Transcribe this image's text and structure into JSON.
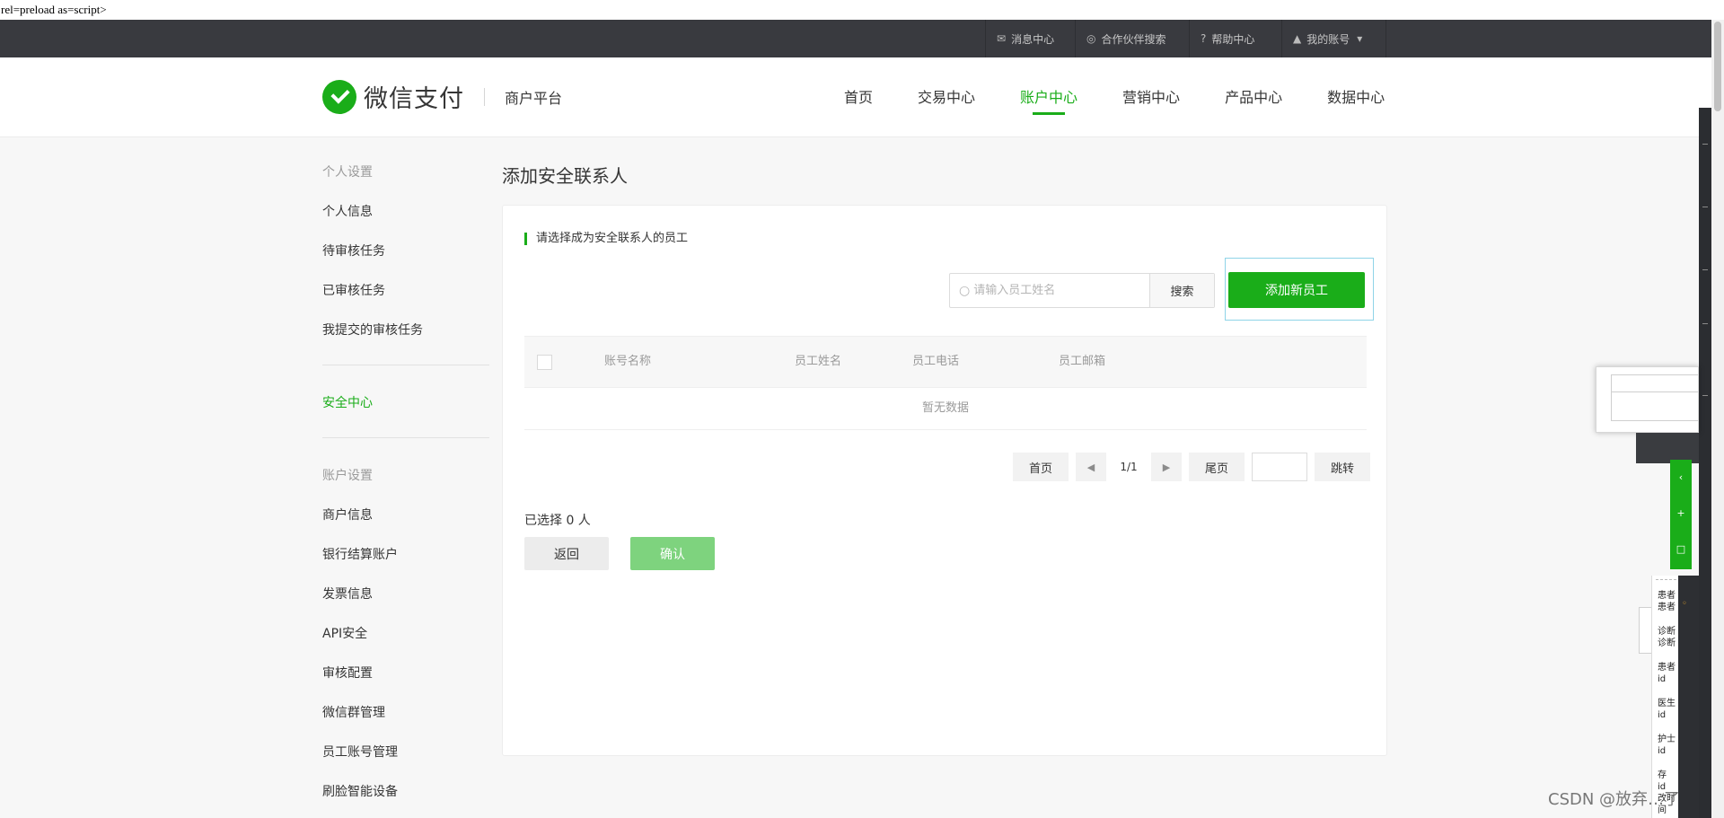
{
  "raw_text": "rel=preload as=script>",
  "topbar": {
    "items": [
      {
        "label": "消息中心",
        "icon": "mail-icon"
      },
      {
        "label": "合作伙伴搜索",
        "icon": "partner-search-icon"
      },
      {
        "label": "帮助中心",
        "icon": "help-icon"
      },
      {
        "label": "我的账号",
        "icon": "user-icon"
      }
    ]
  },
  "header": {
    "brand": "微信支付",
    "platform": "商户平台"
  },
  "nav": {
    "items": [
      "首页",
      "交易中心",
      "账户中心",
      "营销中心",
      "产品中心",
      "数据中心"
    ],
    "active": "账户中心"
  },
  "sidebar": {
    "personal_title": "个人设置",
    "personal_items": [
      "个人信息",
      "待审核任务",
      "已审核任务",
      "我提交的审核任务"
    ],
    "security_item": "安全中心",
    "account_title": "账户设置",
    "account_items": [
      "商户信息",
      "银行结算账户",
      "发票信息",
      "API安全",
      "审核配置",
      "微信群管理",
      "员工账号管理",
      "刷脸智能设备"
    ]
  },
  "page": {
    "title": "添加安全联系人",
    "hint": "请选择成为安全联系人的员工",
    "search": {
      "placeholder": "请输入员工姓名",
      "button": "搜索"
    },
    "add_button": "添加新员工",
    "table": {
      "columns": [
        "账号名称",
        "员工姓名",
        "员工电话",
        "员工邮箱"
      ],
      "empty_text": "暂无数据"
    },
    "pager": {
      "first": "首页",
      "page_info": "1/1",
      "last": "尾页",
      "goto": "跳转"
    },
    "selected_text": "已选择 0 人",
    "back_button": "返回",
    "confirm_button": "确认"
  },
  "overlay": {
    "list_rows": [
      [
        "患者",
        "患者"
      ],
      [
        "诊断",
        "诊断"
      ],
      [
        "患者",
        "id"
      ],
      [
        "医生",
        "id"
      ],
      [
        "护士",
        "id"
      ],
      [
        "存",
        "id",
        "改时间"
      ]
    ]
  },
  "watermark": "CSDN @放弃…了",
  "colors": {
    "accent": "#1aad19",
    "topbar": "#393a3f",
    "confirm_disabled": "#7ed37e"
  }
}
